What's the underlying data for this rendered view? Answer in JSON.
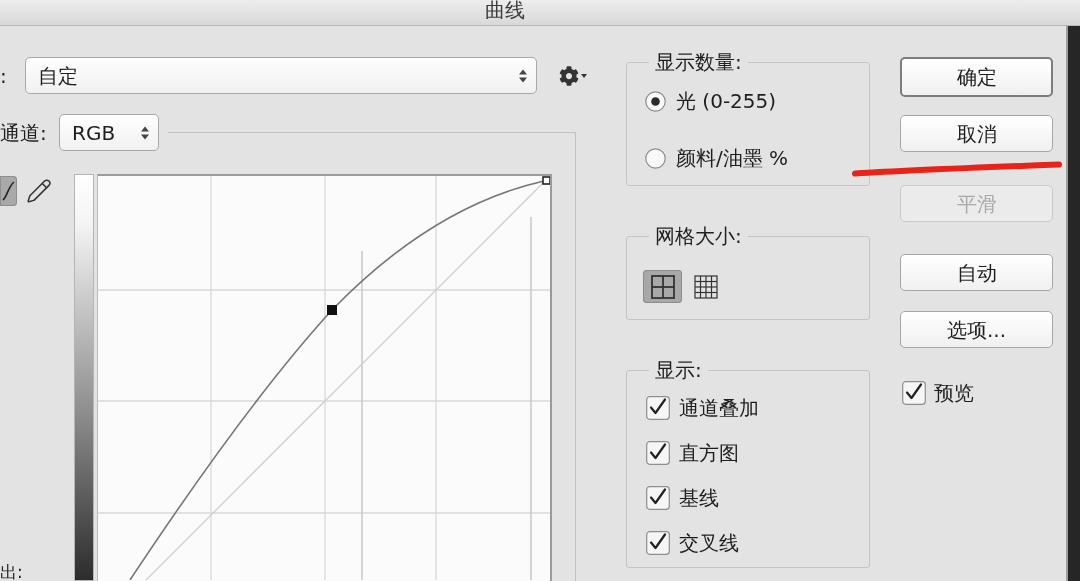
{
  "window": {
    "title": "曲线"
  },
  "preset": {
    "label": ":",
    "value": "自定"
  },
  "channel": {
    "label": "通道:",
    "value": "RGB"
  },
  "tools": [
    {
      "kind": "curve",
      "selected": true
    },
    {
      "kind": "pencil",
      "selected": false
    }
  ],
  "output_label": "出:",
  "show_amount": {
    "title": "显示数量:",
    "options": [
      {
        "label": "光 (0-255)",
        "selected": true
      },
      {
        "label": "颜料/油墨 %",
        "selected": false
      }
    ]
  },
  "grid_size": {
    "title": "网格大小:",
    "options": [
      {
        "kind": "coarse",
        "selected": true
      },
      {
        "kind": "fine",
        "selected": false
      }
    ]
  },
  "display": {
    "title": "显示:",
    "options": [
      {
        "label": "通道叠加",
        "checked": true
      },
      {
        "label": "直方图",
        "checked": true
      },
      {
        "label": "基线",
        "checked": true
      },
      {
        "label": "交叉线",
        "checked": true
      }
    ]
  },
  "buttons": [
    {
      "label": "确定",
      "kind": "default",
      "disabled": false,
      "underlined": false
    },
    {
      "label": "取消",
      "kind": "push",
      "disabled": false,
      "underlined": true
    },
    {
      "label": "平滑",
      "kind": "push",
      "disabled": true,
      "underlined": false
    },
    {
      "label": "自动",
      "kind": "push",
      "disabled": false,
      "underlined": false
    },
    {
      "label": "选项...",
      "kind": "push",
      "disabled": false,
      "underlined": false
    }
  ],
  "preview": {
    "label": "预览",
    "checked": true
  }
}
